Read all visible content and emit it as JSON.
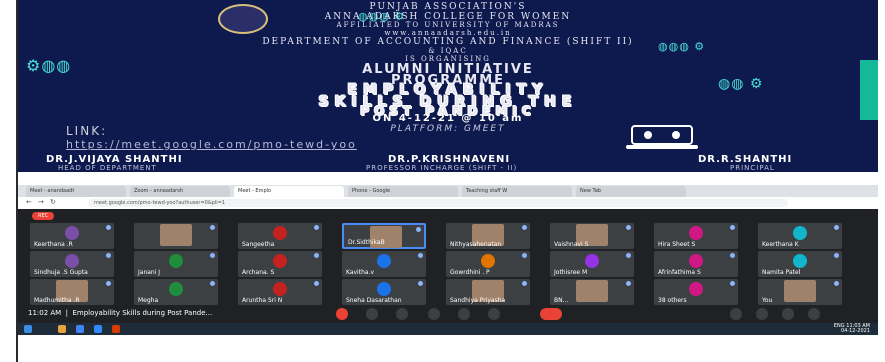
{
  "poster": {
    "line1": "PUNJAB ASSOCIATION'S",
    "line2": "ANNA ADARSH COLLEGE FOR WOMEN",
    "line3": "AFFILIATED TO UNIVERSITY OF MADRAS",
    "line4": "www.annaadarsh.edu.in",
    "line5": "DEPARTMENT OF ACCOUNTING AND FINANCE (SHIFT II)",
    "line6": "& IQAC",
    "line7": "IS ORGANISING",
    "alumni1": "ALUMNI INITIATIVE",
    "alumni2": "PROGRAMME",
    "title1": "EMPLOYABILITY",
    "title2": "SKILLS DURING THE",
    "title3": "POST PANDEMIC",
    "date": "ON 4-12-21 @ 10 am",
    "platform": "PLATFORM: GMEET",
    "link_label": "LINK:",
    "link_url": "https://meet.google.com/pmo-tewd-yoo",
    "people": [
      {
        "name": "DR.J.VIJAYA SHANTHI",
        "role": "HEAD OF DEPARTMENT"
      },
      {
        "name": "DR.P.KRISHNAVENI",
        "role": "PROFESSOR INCHARGE (SHIFT - II)"
      },
      {
        "name": "DR.R.SHANTHI",
        "role": "PRINCIPAL"
      }
    ]
  },
  "meet": {
    "tabs": [
      "Meet - anandaadt",
      "Zoom - annaadarsh",
      "Meet - Emplo",
      "Phone - Google",
      "Teaching staff W",
      "New Tab"
    ],
    "url": "meet.google.com/pmo-tewd-yoo?authuser=0&pli=1",
    "rec_label": "REC",
    "participants": [
      "Keerthana .R",
      "",
      "Sangeetha",
      "Dr.SidthikaB",
      "Nithyasahenatan",
      "Vaishnavi S",
      "Hira Sheet S",
      "Keerthana K",
      "Sindhuja .S Gupta",
      "Janani J",
      "Archana. S",
      "Kavitha.v",
      "Gowrdhini . P",
      "Jothisree M",
      "Afrinfathima S",
      "Namita Patel",
      "Madhumitha .R",
      "Megha",
      "Aruntha Sri N",
      "Sneha Dasarathan",
      "Sandhiya Priyasha",
      "BN...",
      "38 others",
      "You"
    ],
    "meeting_time": "11:02 AM",
    "meeting_title": "Employability Skills during Post Pande...",
    "tray_time": "11:03 AM",
    "tray_date": "04-12-2021",
    "tray_lang": "ENG"
  }
}
